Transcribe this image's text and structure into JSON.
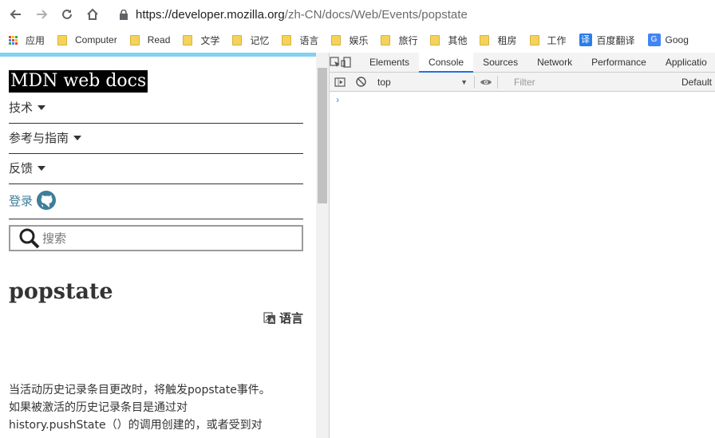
{
  "browser": {
    "url_host": "https://developer.mozilla.org",
    "url_path": "/zh-CN/docs/Web/Events/popstate"
  },
  "bookmarks": {
    "apps_label": "应用",
    "items": [
      {
        "label": "Computer"
      },
      {
        "label": "Read"
      },
      {
        "label": "文学"
      },
      {
        "label": "记忆"
      },
      {
        "label": "语言"
      },
      {
        "label": "娱乐"
      },
      {
        "label": "旅行"
      },
      {
        "label": "其他"
      },
      {
        "label": "租房"
      },
      {
        "label": "工作"
      }
    ],
    "translate_label": "百度翻译",
    "google_label": "Goog"
  },
  "page": {
    "logo": "MDN web docs",
    "menu": [
      {
        "label": "技术"
      },
      {
        "label": "参考与指南"
      },
      {
        "label": "反馈"
      }
    ],
    "login": "登录",
    "search_placeholder": "搜索",
    "title": "popstate",
    "language": "语言",
    "paragraph_lines": [
      "当活动历史记录条目更改时，将触发popstate事件。",
      "如果被激活的历史记录条目是通过对",
      "history.pushState（）的调用创建的，或者受到对"
    ]
  },
  "devtools": {
    "tabs": [
      {
        "label": "Elements"
      },
      {
        "label": "Console"
      },
      {
        "label": "Sources"
      },
      {
        "label": "Network"
      },
      {
        "label": "Performance"
      },
      {
        "label": "Applicatio"
      }
    ],
    "active_tab": "Console",
    "context": "top",
    "filter_placeholder": "Filter",
    "levels": "Default",
    "prompt": "›"
  },
  "colors": {
    "accent_bar": "#83d0f2",
    "link": "#3d7e9a",
    "devtools_active": "#1a73e8"
  }
}
